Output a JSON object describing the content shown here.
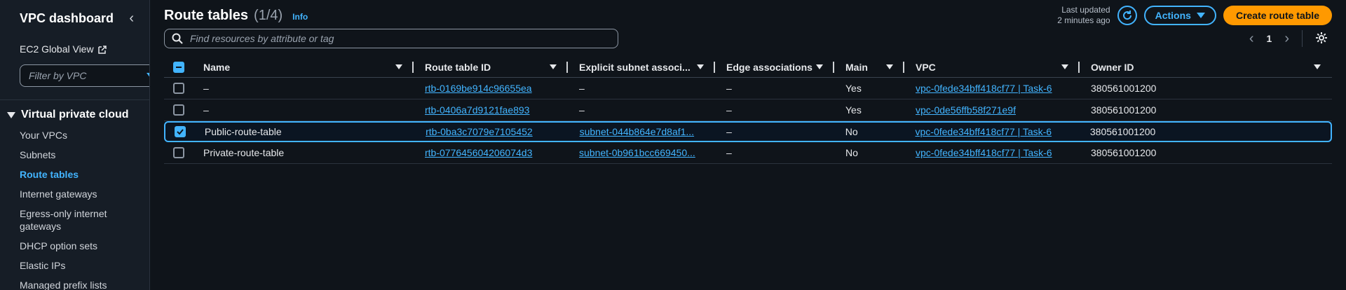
{
  "sidebar": {
    "title": "VPC dashboard",
    "global_view_label": "EC2 Global View",
    "filter_placeholder": "Filter by VPC",
    "section_title": "Virtual private cloud",
    "items": [
      {
        "label": "Your VPCs",
        "active": false
      },
      {
        "label": "Subnets",
        "active": false
      },
      {
        "label": "Route tables",
        "active": true
      },
      {
        "label": "Internet gateways",
        "active": false
      },
      {
        "label": "Egress-only internet gateways",
        "active": false
      },
      {
        "label": "DHCP option sets",
        "active": false
      },
      {
        "label": "Elastic IPs",
        "active": false
      },
      {
        "label": "Managed prefix lists",
        "active": false
      }
    ]
  },
  "header": {
    "title": "Route tables",
    "count": "(1/4)",
    "info": "Info",
    "last_updated_line1": "Last updated",
    "last_updated_line2": "2 minutes ago",
    "actions_label": "Actions",
    "create_label": "Create route table"
  },
  "search": {
    "placeholder": "Find resources by attribute or tag"
  },
  "pagination": {
    "page": "1"
  },
  "table": {
    "columns": [
      "Name",
      "Route table ID",
      "Explicit subnet associ...",
      "Edge associations",
      "Main",
      "VPC",
      "Owner ID"
    ],
    "rows": [
      {
        "name": "–",
        "rtb": "rtb-0169be914c96655ea",
        "subnet": "–",
        "edge": "–",
        "main": "Yes",
        "vpc": "vpc-0fede34bff418cf77 | Task-6",
        "owner": "380561001200",
        "selected": false
      },
      {
        "name": "–",
        "rtb": "rtb-0406a7d9121fae893",
        "subnet": "–",
        "edge": "–",
        "main": "Yes",
        "vpc": "vpc-0de56ffb58f271e9f",
        "owner": "380561001200",
        "selected": false
      },
      {
        "name": "Public-route-table",
        "rtb": "rtb-0ba3c7079e7105452",
        "subnet": "subnet-044b864e7d8af1...",
        "edge": "–",
        "main": "No",
        "vpc": "vpc-0fede34bff418cf77 | Task-6",
        "owner": "380561001200",
        "selected": true
      },
      {
        "name": "Private-route-table",
        "rtb": "rtb-077645604206074d3",
        "subnet": "subnet-0b961bcc669450...",
        "edge": "–",
        "main": "No",
        "vpc": "vpc-0fede34bff418cf77 | Task-6",
        "owner": "380561001200",
        "selected": false
      }
    ]
  },
  "colors": {
    "accent": "#42b4ff",
    "primary_button": "#ff9900",
    "background": "#0f141a",
    "sidebar_background": "#161d26"
  }
}
